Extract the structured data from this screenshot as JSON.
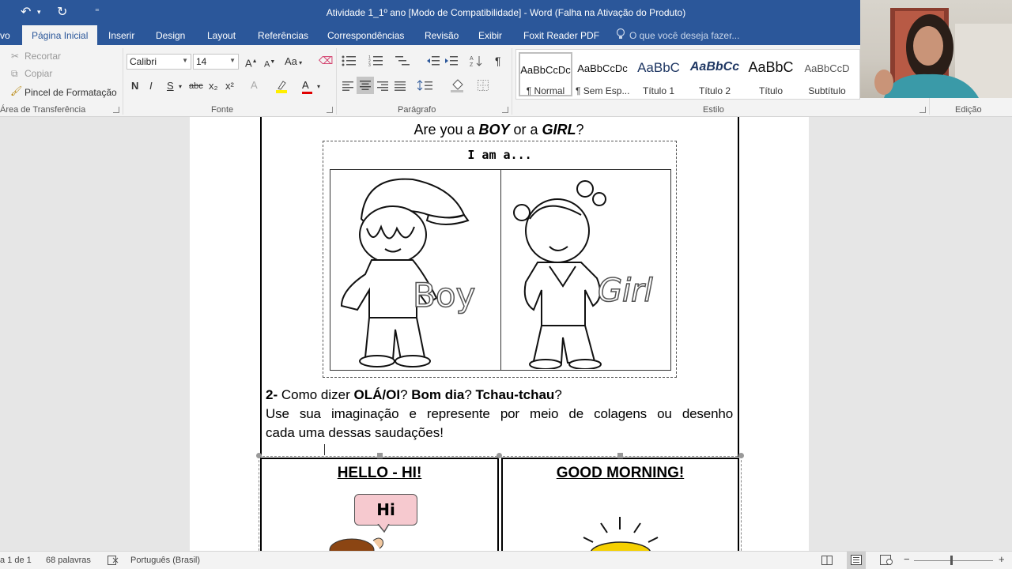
{
  "window": {
    "title": "Atividade 1_1º ano [Modo de Compatibilidade] - Word (Falha na Ativação do Produto)"
  },
  "tabs": [
    {
      "label": "vo"
    },
    {
      "label": "Página Inicial"
    },
    {
      "label": "Inserir"
    },
    {
      "label": "Design"
    },
    {
      "label": "Layout"
    },
    {
      "label": "Referências"
    },
    {
      "label": "Correspondências"
    },
    {
      "label": "Revisão"
    },
    {
      "label": "Exibir"
    },
    {
      "label": "Foxit Reader PDF"
    }
  ],
  "tell_me": "O que você deseja fazer...",
  "clipboard": {
    "cut": "Recortar",
    "copy": "Copiar",
    "format_painter": "Pincel de Formatação",
    "label": "Área de Transferência"
  },
  "font": {
    "name": "Calibri",
    "size": "14",
    "label": "Fonte",
    "bold": "N",
    "italic": "I",
    "underline": "S",
    "strike": "abc",
    "subscript": "x₂",
    "superscript": "x²",
    "case": "Aa",
    "grow": "A",
    "shrink": "A",
    "effects": "A",
    "color": "A"
  },
  "paragraph": {
    "label": "Parágrafo",
    "pilcrow": "¶"
  },
  "styles": {
    "label": "Estilo",
    "items": [
      {
        "preview": "AaBbCcDc",
        "name": "¶ Normal"
      },
      {
        "preview": "AaBbCcDc",
        "name": "¶ Sem Esp..."
      },
      {
        "preview": "AaBbC",
        "name": "Título 1"
      },
      {
        "preview": "AaBbCc",
        "name": "Título 2"
      },
      {
        "preview": "AaBbC",
        "name": "Título"
      },
      {
        "preview": "AaBbCcD",
        "name": "Subtítulo"
      }
    ]
  },
  "editing": {
    "label": "Edição"
  },
  "document": {
    "question_parts": [
      "Are you a ",
      "BOY",
      " or a ",
      "GIRL",
      "?"
    ],
    "iam": "I am a...",
    "boy_word": "Boy",
    "girl_word": "Girl",
    "q2_num": "2-",
    "q2_parts": [
      " Como dizer ",
      "OLÁ/OI",
      "? ",
      "Bom dia",
      "? ",
      "Tchau-tchau",
      "?"
    ],
    "instruction_line1": "Use sua imaginação e represente por meio de colagens ou desenho",
    "instruction_line2": "cada uma dessas saudações!",
    "cell1_title": "HELLO - HI!",
    "cell2_title": "GOOD MORNING!",
    "bubble": "Hi"
  },
  "status": {
    "page": "a 1 de 1",
    "words": "68 palavras",
    "language": "Português (Brasil)"
  }
}
